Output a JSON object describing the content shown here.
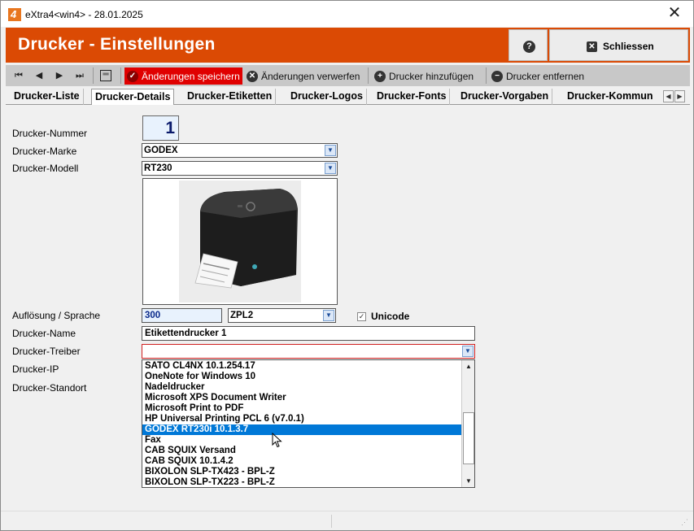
{
  "window": {
    "title": "eXtra4<win4>  -  28.01.2025",
    "logo_letter": "4",
    "close_glyph": "✕"
  },
  "header": {
    "title": "Drucker - Einstellungen",
    "help_label": "?",
    "close_label": "Schliessen"
  },
  "toolbar": {
    "nav": [
      "⏮",
      "◀",
      "▶",
      "⏭"
    ],
    "save_label": "Änderungen speichern",
    "discard_label": "Änderungen verwerfen",
    "add_label": "Drucker hinzufügen",
    "remove_label": "Drucker entfernen",
    "accent": "#db4a04",
    "save_color": "#e00000"
  },
  "tabs": [
    "Drucker-Liste",
    "Drucker-Details",
    "Drucker-Etiketten",
    "Drucker-Logos",
    "Drucker-Fonts",
    "Drucker-Vorgaben",
    "Drucker-Kommun"
  ],
  "active_tab": "Drucker-Details",
  "form": {
    "labels": {
      "number": "Drucker-Nummer",
      "brand": "Drucker-Marke",
      "model": "Drucker-Modell",
      "resolution": "Auflösung / Sprache",
      "name": "Drucker-Name",
      "driver": "Drucker-Treiber",
      "ip": "Drucker-IP",
      "location": "Drucker-Standort"
    },
    "number": "1",
    "brand": "GODEX",
    "model": "RT230",
    "resolution": "300",
    "language": "ZPL2",
    "unicode_label": "Unicode",
    "unicode_checked": true,
    "name": "Etikettendrucker 1",
    "driver": ""
  },
  "driver_dropdown": {
    "items": [
      "SATO CL4NX 10.1.254.17",
      "OneNote for Windows 10",
      "Nadeldrucker",
      "Microsoft XPS Document Writer",
      "Microsoft Print to PDF",
      "HP Universal Printing PCL 6 (v7.0.1)",
      "GODEX RT230i 10.1.3.7",
      "Fax",
      "CAB SQUIX Versand",
      "CAB SQUIX 10.1.4.2",
      "BIXOLON SLP-TX423 - BPL-Z",
      "BIXOLON SLP-TX223 - BPL-Z"
    ],
    "selected_index": 6
  }
}
